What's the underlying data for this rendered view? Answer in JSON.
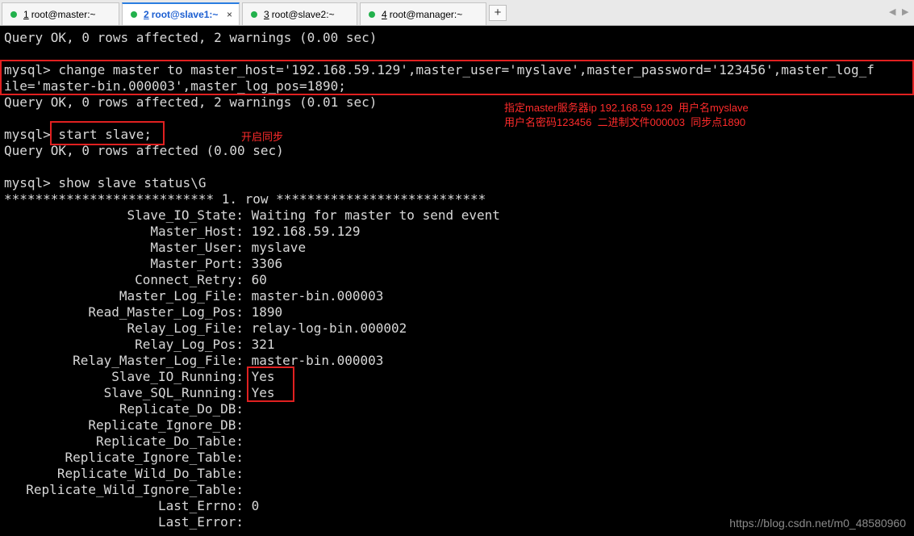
{
  "tabs": [
    {
      "number": "1",
      "label": "root@master:~",
      "active": false,
      "close": "×"
    },
    {
      "number": "2",
      "label": "root@slave1:~",
      "active": true,
      "close": "×"
    },
    {
      "number": "3",
      "label": "root@slave2:~",
      "active": false,
      "close": "×"
    },
    {
      "number": "4",
      "label": "root@manager:~",
      "active": false,
      "close": "×"
    }
  ],
  "new_tab": "+",
  "nav": {
    "prev": "◀",
    "next": "▶"
  },
  "terminal": {
    "lines": [
      "Query OK, 0 rows affected, 2 warnings (0.00 sec)",
      "",
      "mysql> change master to master_host='192.168.59.129',master_user='myslave',master_password='123456',master_log_f",
      "ile='master-bin.000003',master_log_pos=1890;",
      "Query OK, 0 rows affected, 2 warnings (0.01 sec)",
      "",
      "mysql> start slave;",
      "Query OK, 0 rows affected (0.00 sec)",
      "",
      "mysql> show slave status\\G",
      "*************************** 1. row ***************************"
    ],
    "status_fields": [
      {
        "key": "Slave_IO_State:",
        "value": "Waiting for master to send event"
      },
      {
        "key": "Master_Host:",
        "value": "192.168.59.129"
      },
      {
        "key": "Master_User:",
        "value": "myslave"
      },
      {
        "key": "Master_Port:",
        "value": "3306"
      },
      {
        "key": "Connect_Retry:",
        "value": "60"
      },
      {
        "key": "Master_Log_File:",
        "value": "master-bin.000003"
      },
      {
        "key": "Read_Master_Log_Pos:",
        "value": "1890"
      },
      {
        "key": "Relay_Log_File:",
        "value": "relay-log-bin.000002"
      },
      {
        "key": "Relay_Log_Pos:",
        "value": "321"
      },
      {
        "key": "Relay_Master_Log_File:",
        "value": "master-bin.000003"
      },
      {
        "key": "Slave_IO_Running:",
        "value": "Yes"
      },
      {
        "key": "Slave_SQL_Running:",
        "value": "Yes"
      },
      {
        "key": "Replicate_Do_DB:",
        "value": ""
      },
      {
        "key": "Replicate_Ignore_DB:",
        "value": ""
      },
      {
        "key": "Replicate_Do_Table:",
        "value": ""
      },
      {
        "key": "Replicate_Ignore_Table:",
        "value": ""
      },
      {
        "key": "Replicate_Wild_Do_Table:",
        "value": ""
      },
      {
        "key": "Replicate_Wild_Ignore_Table:",
        "value": ""
      },
      {
        "key": "Last_Errno:",
        "value": "0"
      },
      {
        "key": "Last_Error:",
        "value": ""
      }
    ]
  },
  "annotations": {
    "master_note_line1": "指定master服务器ip 192.168.59.129  用户名myslave",
    "master_note_line2": "用户名密码123456  二进制文件000003  同步点1890",
    "start_note": "开启同步"
  },
  "watermark": "https://blog.csdn.net/m0_48580960",
  "colors": {
    "terminal_bg": "#000000",
    "terminal_fg": "#d8d8d8",
    "highlight_box": "#e02020",
    "annotation_text": "#ff2b2b",
    "tab_dot": "#22b14c"
  }
}
